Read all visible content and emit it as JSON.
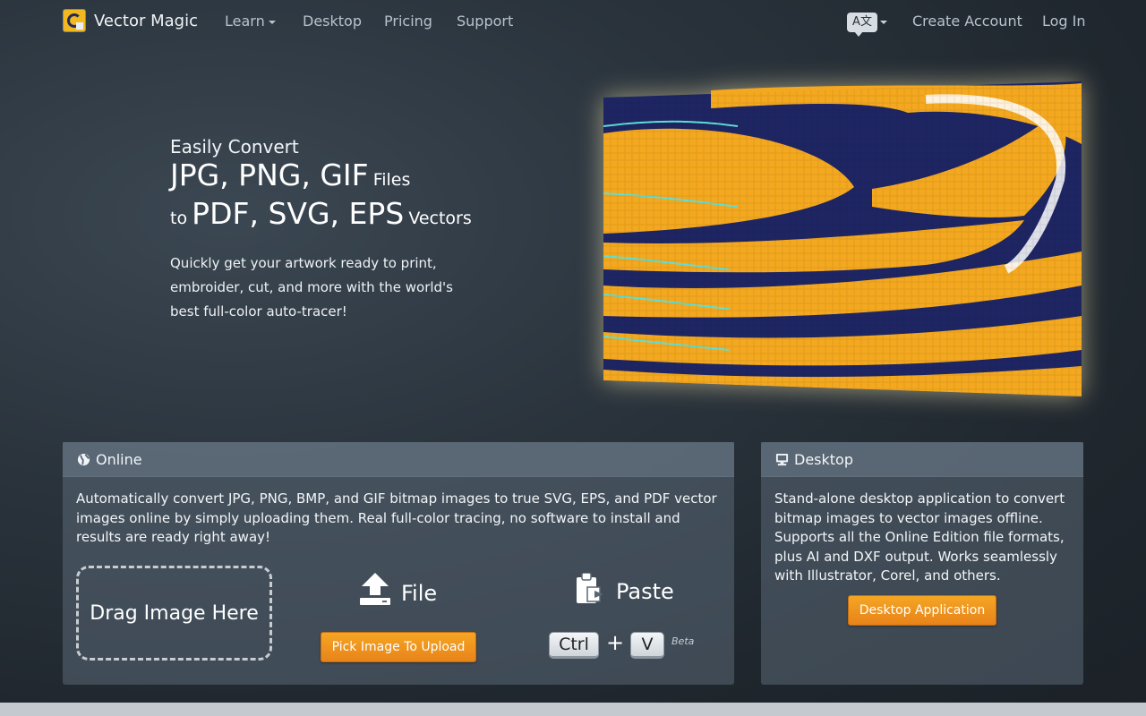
{
  "nav": {
    "brand": "Vector Magic",
    "links": [
      "Learn",
      "Desktop",
      "Pricing",
      "Support"
    ],
    "lang_icon": "A文",
    "create_account": "Create Account",
    "login": "Log In"
  },
  "hero": {
    "kicker": "Easily Convert",
    "formats_in": "JPG, PNG, GIF",
    "files_word": "Files",
    "to_word": "to",
    "formats_out": "PDF, SVG, EPS",
    "vectors_word": "Vectors",
    "description": "Quickly get your artwork ready to print, embroider, cut, and more with the world's best full-color auto-tracer!"
  },
  "online": {
    "title": "Online",
    "text": "Automatically convert JPG, PNG, BMP, and GIF bitmap images to true SVG, EPS, and PDF vector images online by simply uploading them. Real full-color tracing, no software to install and results are ready right away!",
    "drop_label": "Drag Image Here",
    "file_label": "File",
    "upload_button": "Pick Image To Upload",
    "paste_label": "Paste",
    "key_ctrl": "Ctrl",
    "plus": "+",
    "key_v": "V",
    "beta": "Beta"
  },
  "desktop": {
    "title": "Desktop",
    "text": "Stand-alone desktop application to convert bitmap images to vector images offline. Supports all the Online Edition file formats, plus AI and DXF output. Works seamlessly with Illustrator, Corel, and others.",
    "button": "Desktop Application"
  },
  "colors": {
    "accent_orange": "#f5a623",
    "logo_yellow": "#f2b81e",
    "logo_navy": "#1f2b5c"
  }
}
